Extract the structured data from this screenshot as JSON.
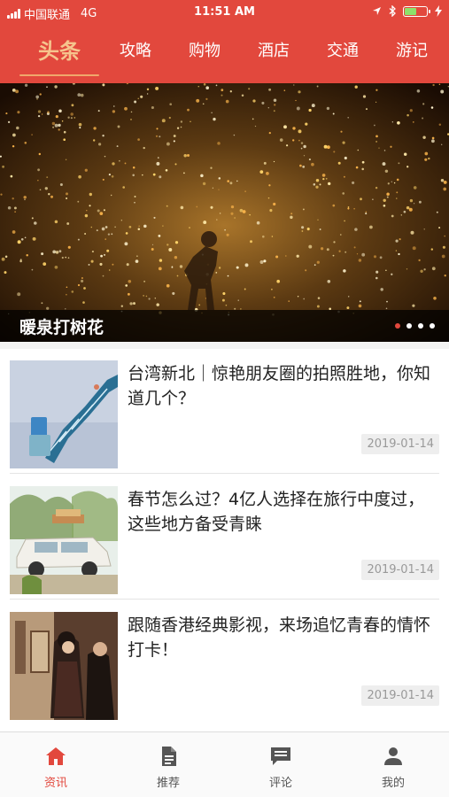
{
  "status_bar": {
    "carrier": "中国联通",
    "network": "4G",
    "time": "11:51 AM"
  },
  "tabs": [
    {
      "label": "头条",
      "active": true
    },
    {
      "label": "攻略",
      "active": false
    },
    {
      "label": "购物",
      "active": false
    },
    {
      "label": "酒店",
      "active": false
    },
    {
      "label": "交通",
      "active": false
    },
    {
      "label": "游记",
      "active": false
    }
  ],
  "banner": {
    "title": "暖泉打树花",
    "slides": 4,
    "current_slide": 1
  },
  "articles": [
    {
      "title": "台湾新北｜惊艳朋友圈的拍照胜地，你知道几个？",
      "date": "2019-01-14",
      "thumb": "spiral-staircase-photo"
    },
    {
      "title": "春节怎么过？4亿人选择在旅行中度过，这些地方备受青睐",
      "date": "2019-01-14",
      "thumb": "vintage-car-photo"
    },
    {
      "title": "跟随香港经典影视，来场追忆青春的情怀打卡！",
      "date": "2019-01-14",
      "thumb": "movie-still-photo"
    }
  ],
  "bottom_nav": [
    {
      "label": "资讯",
      "icon": "home-icon",
      "active": true
    },
    {
      "label": "推荐",
      "icon": "document-icon",
      "active": false
    },
    {
      "label": "评论",
      "icon": "comment-icon",
      "active": false
    },
    {
      "label": "我的",
      "icon": "person-icon",
      "active": false
    }
  ],
  "colors": {
    "brand": "#e2483d",
    "active_tab": "#f6c48d",
    "battery": "#8ee06a"
  }
}
